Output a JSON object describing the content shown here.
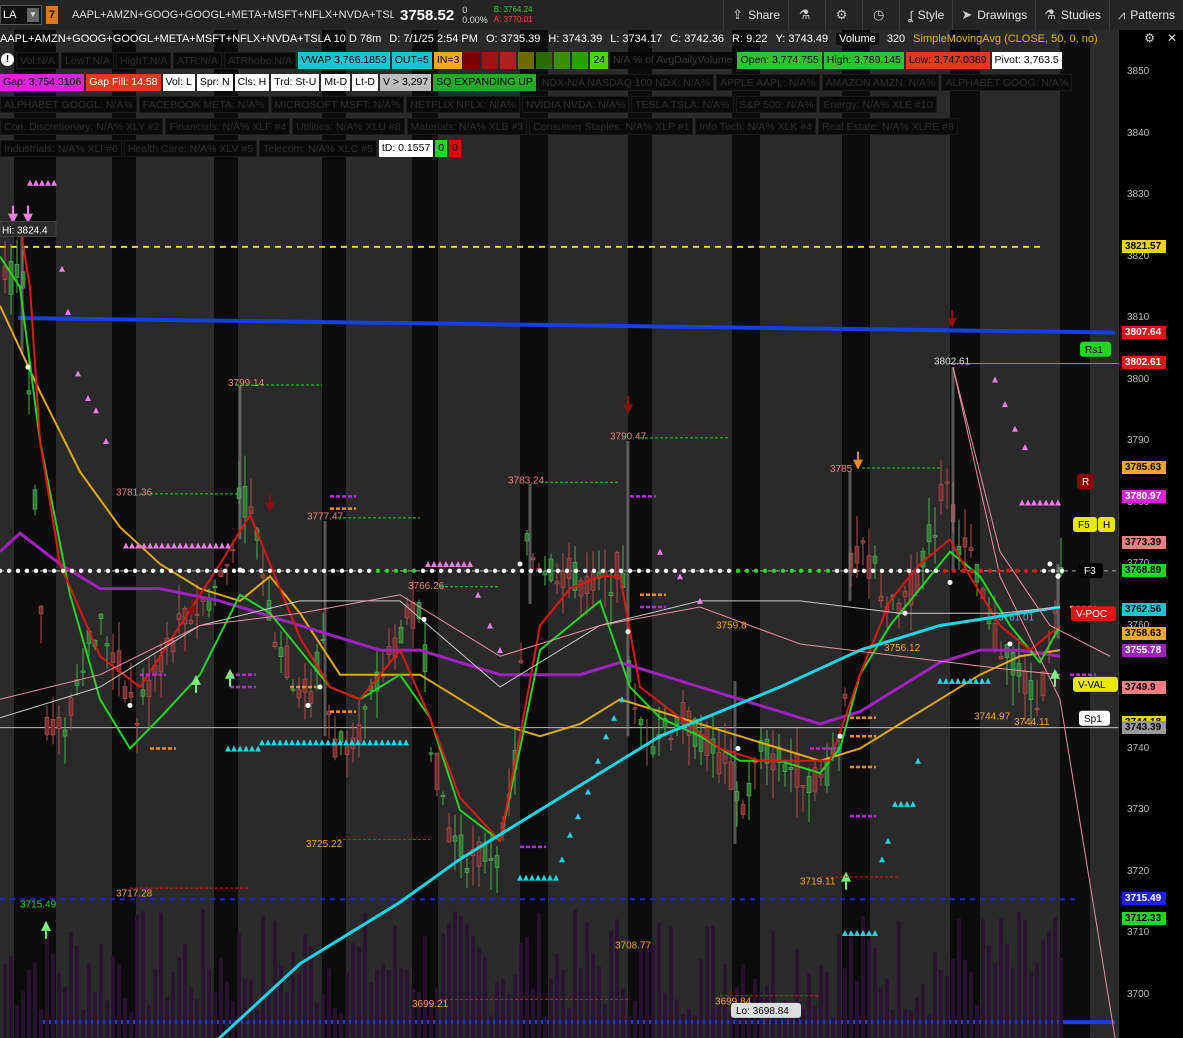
{
  "toolbar": {
    "symbol": "LA",
    "link_number": "7",
    "description": "AAPL+AMZN+GOOG+GOOGL+META+MSFT+NFLX+NVDA+TSLA",
    "last_price": "3758.52",
    "change": "0",
    "change_pct": "0.00%",
    "bid": "B: 3764.24",
    "ask": "A: 3770.01",
    "share_label": "Share",
    "style_label": "Style",
    "drawings_label": "Drawings",
    "studies_label": "Studies",
    "patterns_label": "Patterns"
  },
  "chart_header": {
    "title": "AAPL+AMZN+GOOG+GOOGL+META+MSFT+NFLX+NVDA+TSLA 10 D 78m",
    "date": "D: 7/1/25 2:54 PM",
    "open": "O: 3735.39",
    "high": "H: 3743.39",
    "low": "L: 3734.17",
    "close": "C: 3742.36",
    "range": "R: 9.22",
    "y": "Y: 3743.49",
    "volume_label": "Volume",
    "volume_value": "320",
    "sma_label": "SimpleMovingAvg (CLOSE, 50, 0, no)"
  },
  "row1": [
    {
      "text": "Vol:N/A",
      "bg": "#0a0a0a",
      "fg": "#2e2e2e"
    },
    {
      "text": "LowT:N/A",
      "bg": "#0a0a0a",
      "fg": "#2e2e2e"
    },
    {
      "text": "HighT:N/A",
      "bg": "#0a0a0a",
      "fg": "#2e2e2e"
    },
    {
      "text": "ATR:N/A",
      "bg": "#0a0a0a",
      "fg": "#2e2e2e"
    },
    {
      "text": "ATRhobo:N/A",
      "bg": "#0a0a0a",
      "fg": "#2e2e2e"
    },
    {
      "text": "VWAP 3,766.1853",
      "bg": "#19c3d6",
      "fg": "#000"
    },
    {
      "text": "OUT=5",
      "bg": "#19c3d6",
      "fg": "#000"
    },
    {
      "text": "IN=3",
      "bg": "#f5a623",
      "fg": "#000"
    },
    {
      "text": "",
      "bg": "#7a0000",
      "fg": "#000",
      "w": 16
    },
    {
      "text": "",
      "bg": "#a31212",
      "fg": "#000",
      "w": 16
    },
    {
      "text": "",
      "bg": "#b01e1e",
      "fg": "#000",
      "w": 16
    },
    {
      "text": "",
      "bg": "#6b6b00",
      "fg": "#000",
      "w": 16
    },
    {
      "text": "",
      "bg": "#2a6d00",
      "fg": "#000",
      "w": 16
    },
    {
      "text": "",
      "bg": "#3c8f00",
      "fg": "#000",
      "w": 16
    },
    {
      "text": "",
      "bg": "#27a200",
      "fg": "#000",
      "w": 16
    },
    {
      "text": "24",
      "bg": "#4ad600",
      "fg": "#000"
    },
    {
      "text": "N/A % of AvgDailyVolume",
      "bg": "#080808",
      "fg": "#3a3a3a"
    },
    {
      "text": "Open: 3,774.755",
      "bg": "#30c030",
      "fg": "#000"
    },
    {
      "text": "High: 3,789.145",
      "bg": "#30c030",
      "fg": "#000"
    },
    {
      "text": "Low: 3,747.0389",
      "bg": "#e03a1a",
      "fg": "#000"
    },
    {
      "text": "Pivot: 3,763.5",
      "bg": "#ffffff",
      "fg": "#000"
    }
  ],
  "row2": [
    {
      "text": "Gap: 3,754.3106",
      "bg": "#e020e0",
      "fg": "#000"
    },
    {
      "text": "Gap Fill: 14.58",
      "bg": "#e03a1a",
      "fg": "#fff"
    },
    {
      "text": "Vol: L",
      "bg": "#ffffff",
      "fg": "#000"
    },
    {
      "text": "Spr: N",
      "bg": "#ffffff",
      "fg": "#000"
    },
    {
      "text": "Cls: H",
      "bg": "#ffffff",
      "fg": "#000"
    },
    {
      "text": "Trd: St-U",
      "bg": "#ffffff",
      "fg": "#000"
    },
    {
      "text": "Mt-D",
      "bg": "#ffffff",
      "fg": "#000"
    },
    {
      "text": "Lt-D",
      "bg": "#ffffff",
      "fg": "#000"
    },
    {
      "text": "V > 3,297",
      "bg": "#bdbdbd",
      "fg": "#000"
    },
    {
      "text": "SQ EXPANDING UP",
      "bg": "#1fae1f",
      "fg": "#000"
    },
    {
      "text": "NDX-N/A NASDAQ 100 NDX: N/A%",
      "bg": "#0a0a0a",
      "fg": "#2e2e2e"
    },
    {
      "text": "APPLE AAPL: N/A%",
      "bg": "#0a0a0a",
      "fg": "#2e2e2e"
    },
    {
      "text": "AMAZON AMZN: N/A%",
      "bg": "#0a0a0a",
      "fg": "#2e2e2e"
    },
    {
      "text": "ALPHABET GOOG: N/A%",
      "bg": "#0a0a0a",
      "fg": "#2e2e2e"
    }
  ],
  "row3": [
    {
      "text": "ALPHABET GOOGL: N/A%",
      "bg": "#0a0a0a",
      "fg": "#2e2e2e"
    },
    {
      "text": "FACEBOOK META: N/A%",
      "bg": "#0a0a0a",
      "fg": "#2e2e2e"
    },
    {
      "text": "MICROSOFT MSFT: N/A%",
      "bg": "#0a0a0a",
      "fg": "#2e2e2e"
    },
    {
      "text": "NETFLIX NFLX: N/A%",
      "bg": "#0a0a0a",
      "fg": "#2e2e2e"
    },
    {
      "text": "NVIDIA NVDA: N/A%",
      "bg": "#0a0a0a",
      "fg": "#2e2e2e"
    },
    {
      "text": "TESLA TSLA: N/A%",
      "bg": "#0a0a0a",
      "fg": "#2e2e2e"
    },
    {
      "text": "S&P 500: N/A%",
      "bg": "#0a0a0a",
      "fg": "#2e2e2e"
    },
    {
      "text": "Energy: N/A% XLE #10",
      "bg": "#0a0a0a",
      "fg": "#2e2e2e"
    }
  ],
  "row4": [
    {
      "text": "Con. Discretionary: N/A% XLY #2",
      "bg": "#0a0a0a",
      "fg": "#2e2e2e"
    },
    {
      "text": "Financials: N/A% XLF #4",
      "bg": "#0a0a0a",
      "fg": "#2e2e2e"
    },
    {
      "text": "Utilities: N/A% XLU #8",
      "bg": "#0a0a0a",
      "fg": "#2e2e2e"
    },
    {
      "text": "Materials: N/A% XLB #3",
      "bg": "#0a0a0a",
      "fg": "#2e2e2e"
    },
    {
      "text": "Consumer Staples: N/A% XLP #1",
      "bg": "#0a0a0a",
      "fg": "#2e2e2e"
    },
    {
      "text": "Info Tech: N/A% XLK #4",
      "bg": "#0a0a0a",
      "fg": "#2e2e2e"
    },
    {
      "text": "Real Estate: N/A% XLRE #8",
      "bg": "#0a0a0a",
      "fg": "#2e2e2e"
    }
  ],
  "row5": [
    {
      "text": "Industrials: N/A% XLI #6",
      "bg": "#0a0a0a",
      "fg": "#2e2e2e"
    },
    {
      "text": "Health Care: N/A% XLV #5",
      "bg": "#0a0a0a",
      "fg": "#2e2e2e"
    },
    {
      "text": "Telecom: N/A% XLC #5",
      "bg": "#0a0a0a",
      "fg": "#2e2e2e"
    },
    {
      "text": "tD: 0.1557",
      "bg": "#ffffff",
      "fg": "#000"
    },
    {
      "text": "0",
      "bg": "#1fd61f",
      "fg": "#000"
    },
    {
      "text": "0",
      "bg": "#e00000",
      "fg": "#000"
    }
  ],
  "axis": {
    "ticks": [
      "3850",
      "3840",
      "3830",
      "3820",
      "3810",
      "3800",
      "3790",
      "3780",
      "3770",
      "3760",
      "3750",
      "3740",
      "3730",
      "3720",
      "3710",
      "3700"
    ],
    "labels": [
      {
        "text": "3821.57",
        "bg": "#e8d400",
        "fg": "#000",
        "price": 3821.57
      },
      {
        "text": "3807.64",
        "bg": "#e01515",
        "fg": "#fff",
        "price": 3807.64
      },
      {
        "text": "3802.61",
        "bg": "#e01515",
        "fg": "#fff",
        "price": 3802.61
      },
      {
        "text": "3785.63",
        "bg": "#f5a623",
        "fg": "#000",
        "price": 3785.63
      },
      {
        "text": "3780.97",
        "bg": "#e020e0",
        "fg": "#fff",
        "price": 3780.97
      },
      {
        "text": "3773.39",
        "bg": "#f08080",
        "fg": "#000",
        "price": 3773.39
      },
      {
        "text": "3768.89",
        "bg": "#1fd61f",
        "fg": "#000",
        "price": 3768.89
      },
      {
        "text": "3762.56",
        "bg": "#19c3d6",
        "fg": "#000",
        "price": 3762.56
      },
      {
        "text": "3758.63",
        "bg": "#f5a623",
        "fg": "#000",
        "price": 3758.63
      },
      {
        "text": "3755.78",
        "bg": "#a020c0",
        "fg": "#fff",
        "price": 3755.78
      },
      {
        "text": "3749.9",
        "bg": "#f08080",
        "fg": "#000",
        "price": 3749.9
      },
      {
        "text": "3744.18",
        "bg": "#e8d400",
        "fg": "#000",
        "price": 3744.18
      },
      {
        "text": "3743.39",
        "bg": "#9a9a9a",
        "fg": "#000",
        "price": 3743.39
      },
      {
        "text": "3715.49",
        "bg": "#2020e0",
        "fg": "#fff",
        "price": 3715.49
      },
      {
        "text": "3712.33",
        "bg": "#1fd61f",
        "fg": "#000",
        "price": 3712.33
      }
    ]
  },
  "annotations": {
    "hi": "Hi: 3824.4",
    "lo": "Lo: 3698.84",
    "notes": [
      {
        "text": "3799.14",
        "color": "#f08080"
      },
      {
        "text": "3781.36",
        "color": "#f08080"
      },
      {
        "text": "3777.47",
        "color": "#f08080"
      },
      {
        "text": "3766.26",
        "color": "#f08080"
      },
      {
        "text": "3783.24",
        "color": "#f08080"
      },
      {
        "text": "3790.47",
        "color": "#f08080"
      },
      {
        "text": "3785",
        "color": "#f08080"
      },
      {
        "text": "3802.61",
        "color": "#dddddd"
      },
      {
        "text": "3761.01",
        "color": "#19c3d6"
      },
      {
        "text": "3756.12",
        "color": "#f5a623"
      },
      {
        "text": "3744.97",
        "color": "#f5a623"
      },
      {
        "text": "3744.11",
        "color": "#f5a623"
      },
      {
        "text": "3725.22",
        "color": "#f5a623"
      },
      {
        "text": "3717.28",
        "color": "#f5a623"
      },
      {
        "text": "3715.49",
        "color": "#1fd61f"
      },
      {
        "text": "3719.11",
        "color": "#f5a623"
      },
      {
        "text": "3708.77",
        "color": "#f5a623"
      },
      {
        "text": "3699.21",
        "color": "#f5a623"
      },
      {
        "text": "3699.84",
        "color": "#f5a623"
      },
      {
        "text": "3759.8",
        "color": "#f5a623"
      }
    ],
    "bubbles": [
      {
        "text": "Rs1",
        "bg": "#1fd61f",
        "fg": "#000"
      },
      {
        "text": "F5",
        "bg": "#e8e800",
        "fg": "#000"
      },
      {
        "text": "H",
        "bg": "#e8e800",
        "fg": "#000"
      },
      {
        "text": "F3",
        "bg": "#000",
        "fg": "#fff"
      },
      {
        "text": "V-POC",
        "bg": "#e01515",
        "fg": "#fff"
      },
      {
        "text": "V-VAL",
        "bg": "#e8e800",
        "fg": "#000"
      },
      {
        "text": "Sp1",
        "bg": "#ffffff",
        "fg": "#000"
      },
      {
        "text": "R",
        "bg": "#8b0000",
        "fg": "#fff"
      }
    ]
  }
}
